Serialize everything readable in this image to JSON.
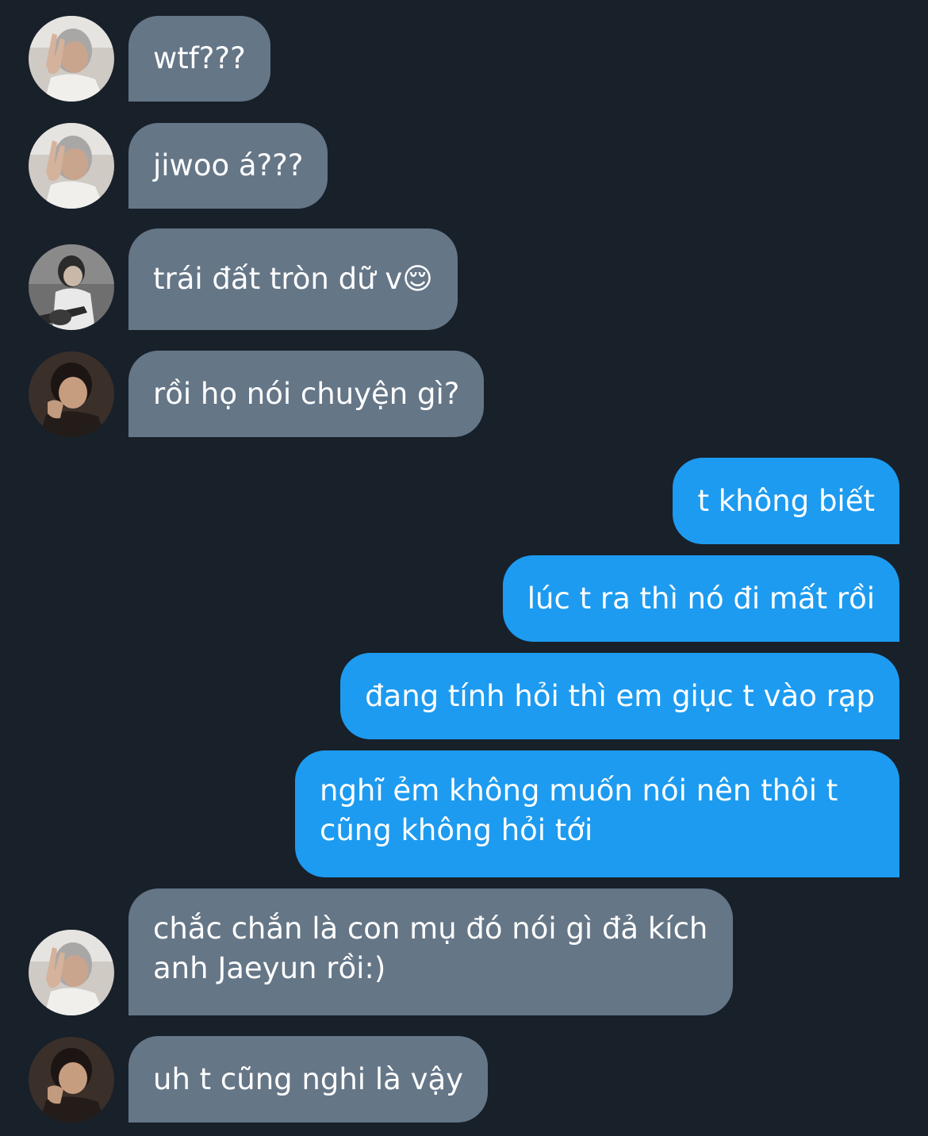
{
  "messages": [
    {
      "id": "m1",
      "side": "in",
      "avatar": "avatar-a",
      "text": "wtf???"
    },
    {
      "id": "m2",
      "side": "in",
      "avatar": "avatar-a",
      "text": "jiwoo á???"
    },
    {
      "id": "m3",
      "side": "in",
      "avatar": "avatar-b",
      "text": "trái đất tròn dữ v😌"
    },
    {
      "id": "m4",
      "side": "in",
      "avatar": "avatar-c",
      "text": "rồi họ nói chuyện gì?"
    },
    {
      "id": "m5",
      "side": "out",
      "text": "t không biết"
    },
    {
      "id": "m6",
      "side": "out",
      "text": "lúc t ra thì nó đi mất rồi"
    },
    {
      "id": "m7",
      "side": "out",
      "text": "đang tính hỏi thì em giục t vào rạp"
    },
    {
      "id": "m8",
      "side": "out",
      "text": "nghĩ ẻm không muốn nói nên thôi t cũng không hỏi tới"
    },
    {
      "id": "m9",
      "side": "in",
      "avatar": "avatar-a",
      "text": "chắc chắn là con mụ đó nói gì đả kích anh Jaeyun rồi:)"
    },
    {
      "id": "m10",
      "side": "in",
      "avatar": "avatar-c",
      "text": "uh t cũng nghi là vậy"
    }
  ],
  "colors": {
    "background": "#18202a",
    "incoming_bubble": "#657687",
    "outgoing_bubble": "#1d9bf0",
    "text": "#ffffff"
  },
  "icons": {
    "avatar-a": "person-peace-sign-photo",
    "avatar-b": "person-with-guitar-photo",
    "avatar-c": "person-dark-hair-photo"
  }
}
